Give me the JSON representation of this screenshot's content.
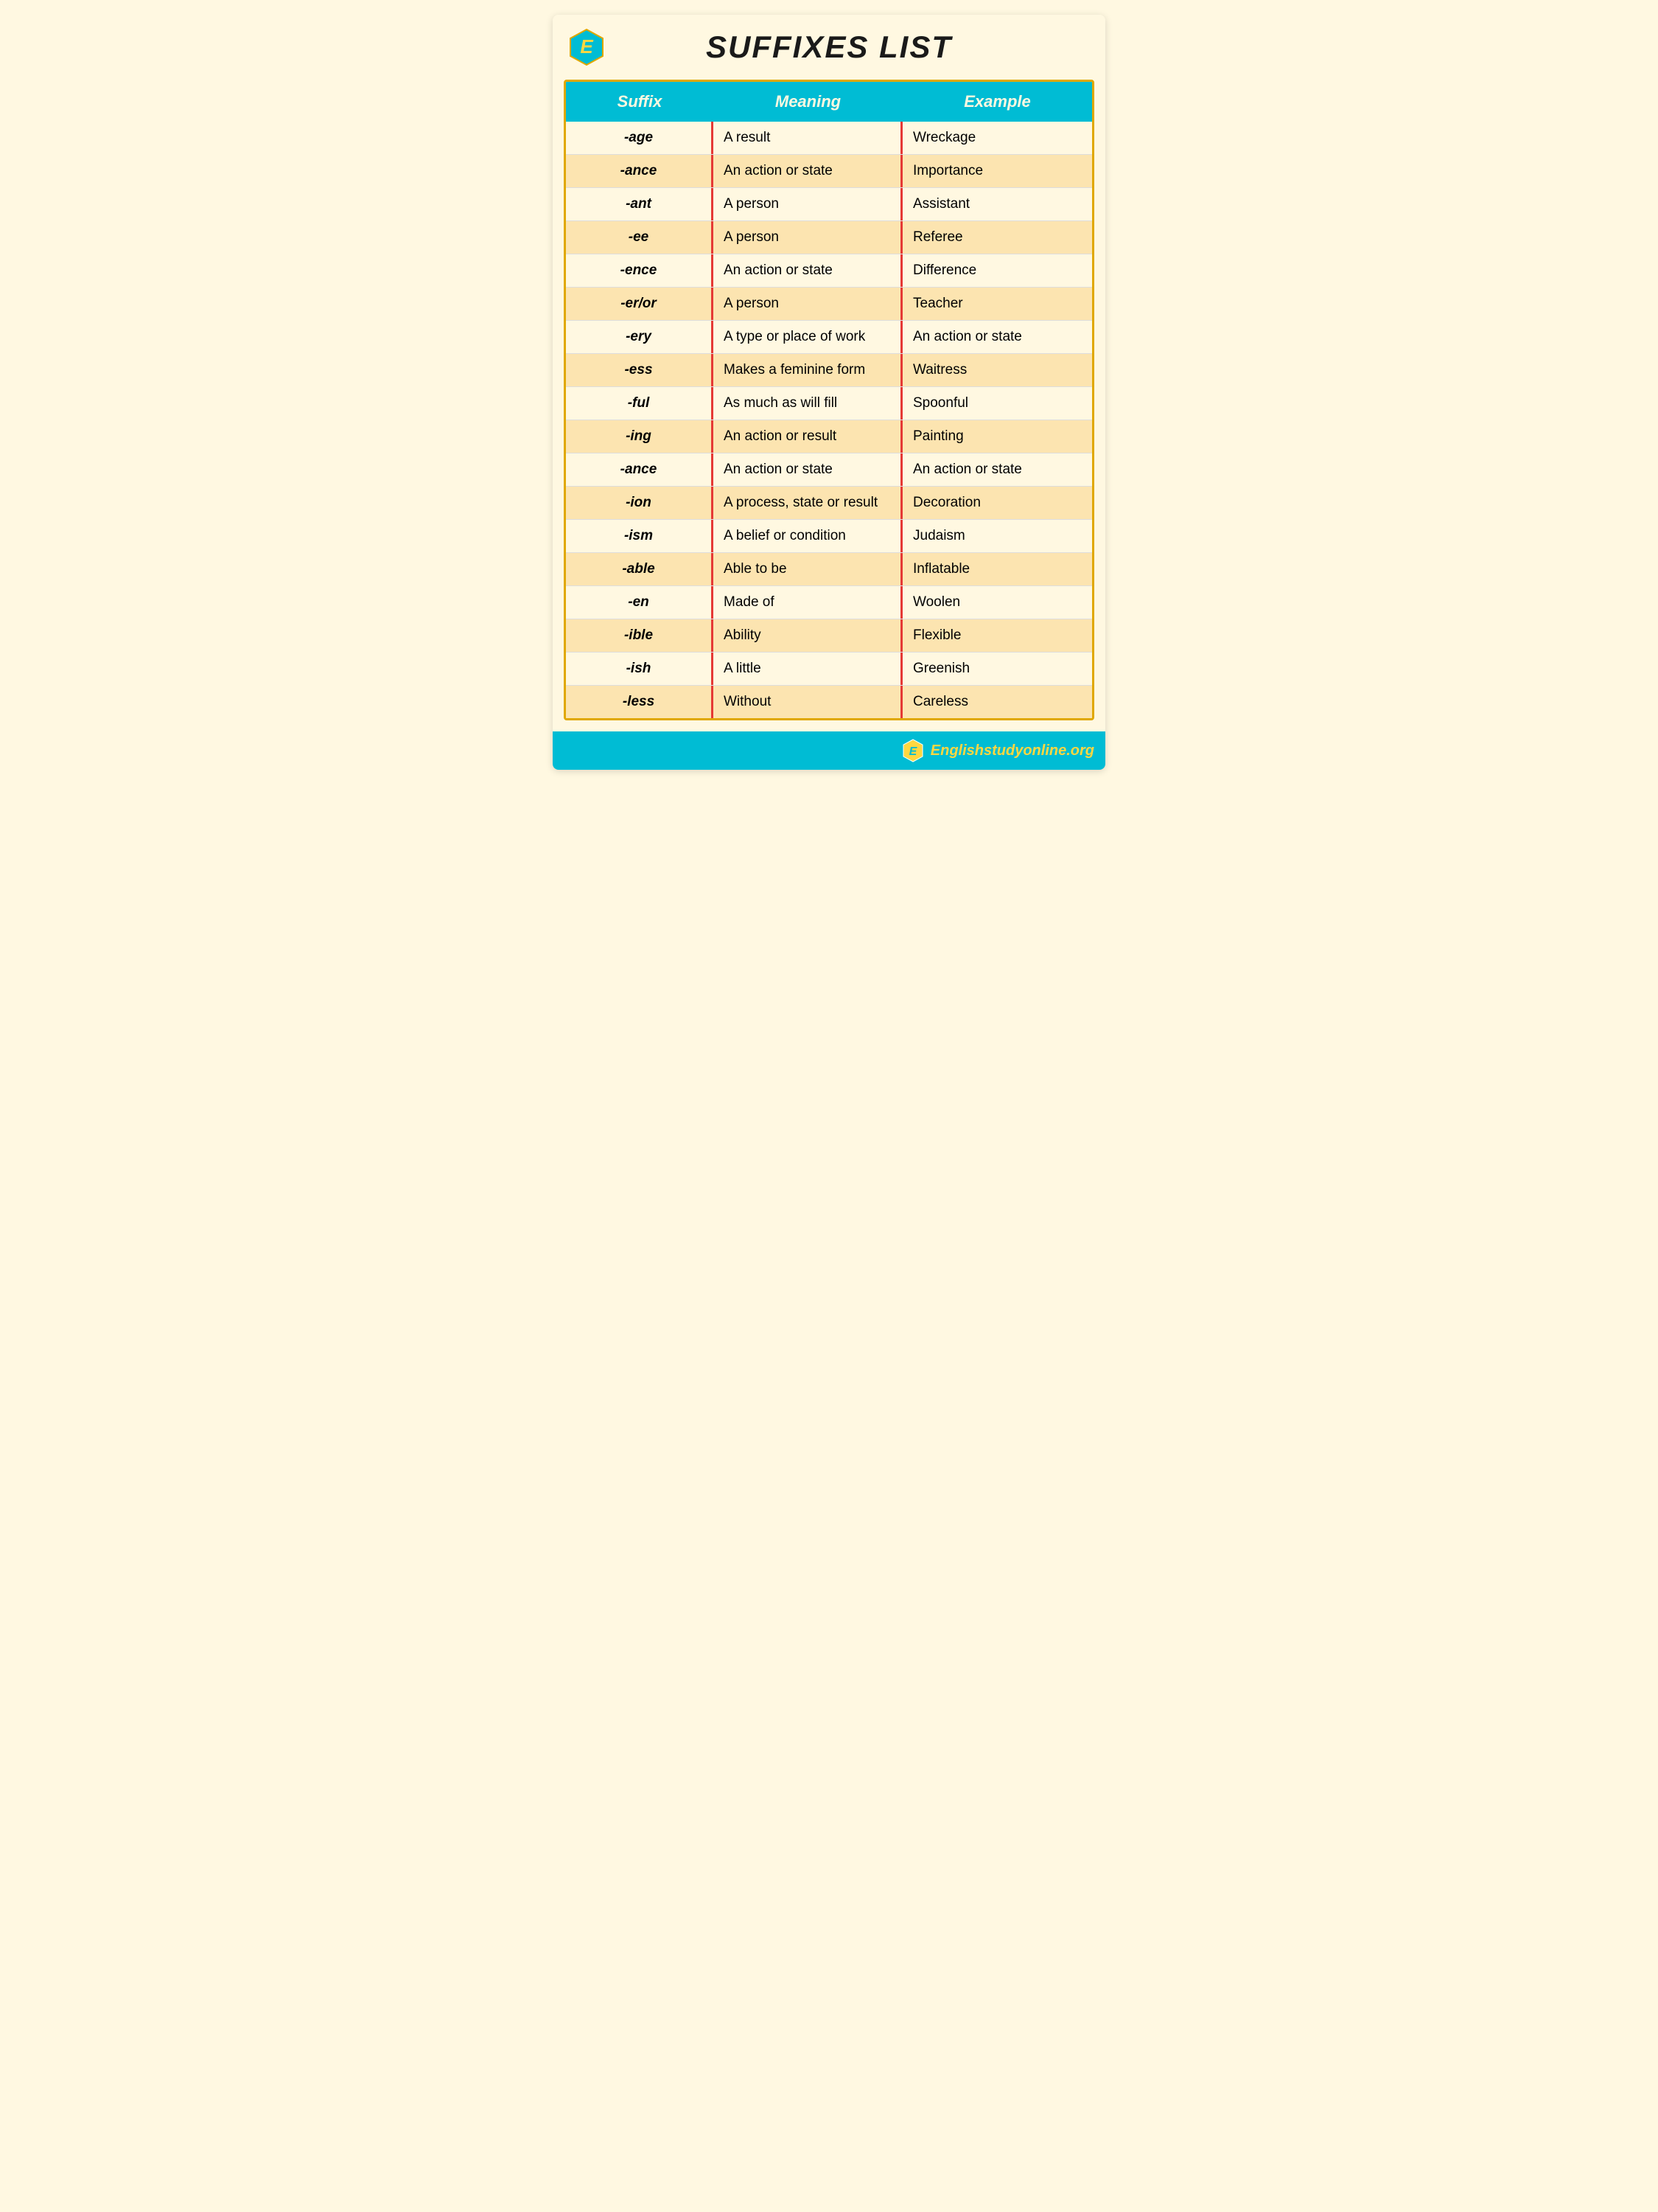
{
  "page": {
    "title": "SUFFIXES LIST",
    "logo_letter": "E",
    "footer_text_brand": "E",
    "footer_text_domain": "nglishstudyonline.org"
  },
  "table": {
    "headers": {
      "suffix": "Suffix",
      "meaning": "Meaning",
      "example": "Example"
    },
    "rows": [
      {
        "suffix": "-age",
        "meaning": "A result",
        "example": "Wreckage"
      },
      {
        "suffix": "-ance",
        "meaning": "An action or state",
        "example": "Importance"
      },
      {
        "suffix": "-ant",
        "meaning": "A person",
        "example": "Assistant"
      },
      {
        "suffix": "-ee",
        "meaning": "A person",
        "example": "Referee"
      },
      {
        "suffix": "-ence",
        "meaning": "An action or state",
        "example": "Difference"
      },
      {
        "suffix": "-er/or",
        "meaning": "A person",
        "example": "Teacher"
      },
      {
        "suffix": "-ery",
        "meaning": "A type or place of work",
        "example": "An action or state"
      },
      {
        "suffix": "-ess",
        "meaning": "Makes a feminine form",
        "example": "Waitress"
      },
      {
        "suffix": "-ful",
        "meaning": "As much as will fill",
        "example": "Spoonful"
      },
      {
        "suffix": "-ing",
        "meaning": "An action or result",
        "example": "Painting"
      },
      {
        "suffix": "-ance",
        "meaning": "An action or state",
        "example": "An action or state"
      },
      {
        "suffix": "-ion",
        "meaning": "A process, state or result",
        "example": "Decoration"
      },
      {
        "suffix": "-ism",
        "meaning": "A belief or condition",
        "example": "Judaism"
      },
      {
        "suffix": "-able",
        "meaning": "Able to be",
        "example": "Inflatable"
      },
      {
        "suffix": "-en",
        "meaning": "Made of",
        "example": "Woolen"
      },
      {
        "suffix": "-ible",
        "meaning": "Ability",
        "example": "Flexible"
      },
      {
        "suffix": "-ish",
        "meaning": "A little",
        "example": "Greenish"
      },
      {
        "suffix": "-less",
        "meaning": "Without",
        "example": "Careless"
      }
    ]
  }
}
